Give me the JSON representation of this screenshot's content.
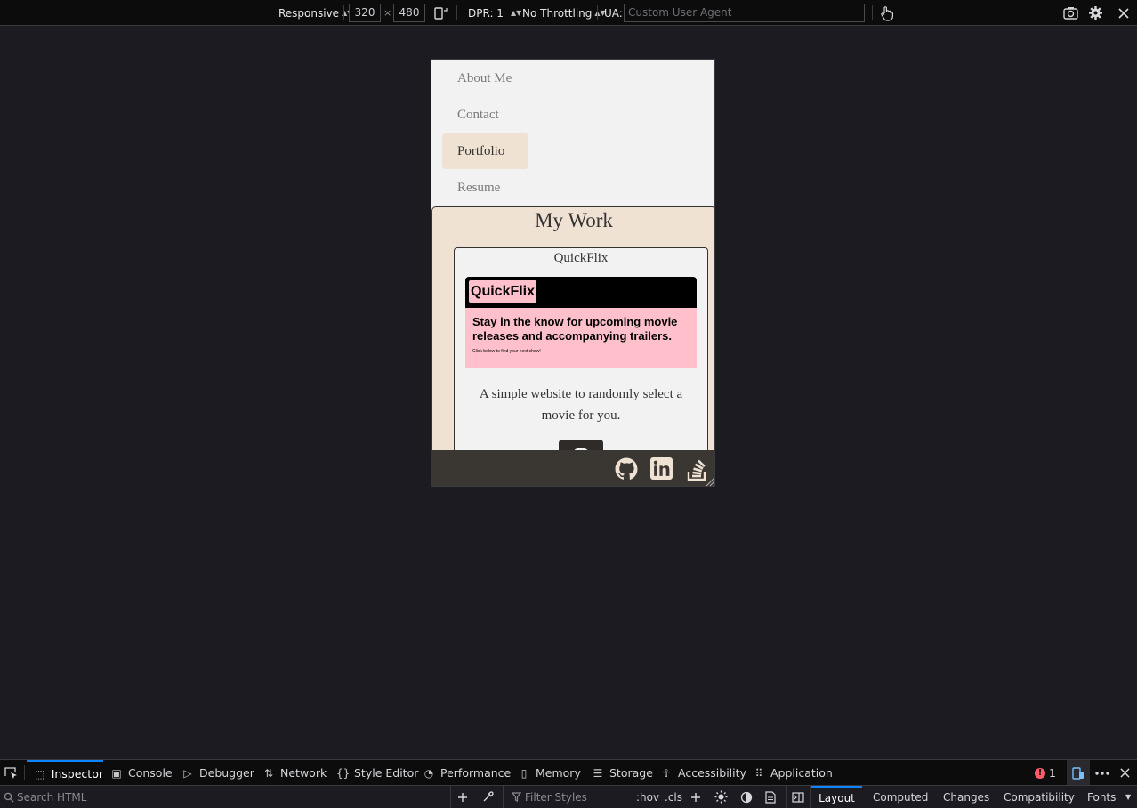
{
  "toolbar": {
    "device": "Responsive",
    "width": "320",
    "times": "×",
    "height": "480",
    "dpr": "DPR: 1",
    "throttling": "No Throttling",
    "ua_label": "UA:",
    "ua_placeholder": "Custom User Agent"
  },
  "page": {
    "nav": [
      {
        "label": "About Me"
      },
      {
        "label": "Contact"
      },
      {
        "label": "Portfolio"
      },
      {
        "label": "Resume"
      }
    ],
    "section_title": "My Work",
    "card": {
      "title": "QuickFlix",
      "logo": "QuickFlix",
      "tagline": "Stay in the know for upcoming movie releases and accompanying trailers.",
      "small": "Click below to find your next show!",
      "description": "A simple website to randomly select a movie for you."
    },
    "colors": {
      "accent": "#f0e2d3",
      "footer": "#3a3632",
      "pink": "#ffc0cb"
    }
  },
  "devtools": {
    "tabs": [
      {
        "label": "Inspector",
        "icon": "inspector-icon"
      },
      {
        "label": "Console",
        "icon": "console-icon"
      },
      {
        "label": "Debugger",
        "icon": "debugger-icon"
      },
      {
        "label": "Network",
        "icon": "network-icon"
      },
      {
        "label": "Style Editor",
        "icon": "style-editor-icon"
      },
      {
        "label": "Performance",
        "icon": "performance-icon"
      },
      {
        "label": "Memory",
        "icon": "memory-icon"
      },
      {
        "label": "Storage",
        "icon": "storage-icon"
      },
      {
        "label": "Accessibility",
        "icon": "accessibility-icon"
      },
      {
        "label": "Application",
        "icon": "application-icon"
      }
    ],
    "error_count": "1",
    "search_placeholder": "Search HTML",
    "filter_placeholder": "Filter Styles",
    "hov": ":hov",
    "cls": ".cls",
    "side_tabs": [
      "Layout",
      "Computed",
      "Changes",
      "Compatibility",
      "Fonts"
    ]
  }
}
